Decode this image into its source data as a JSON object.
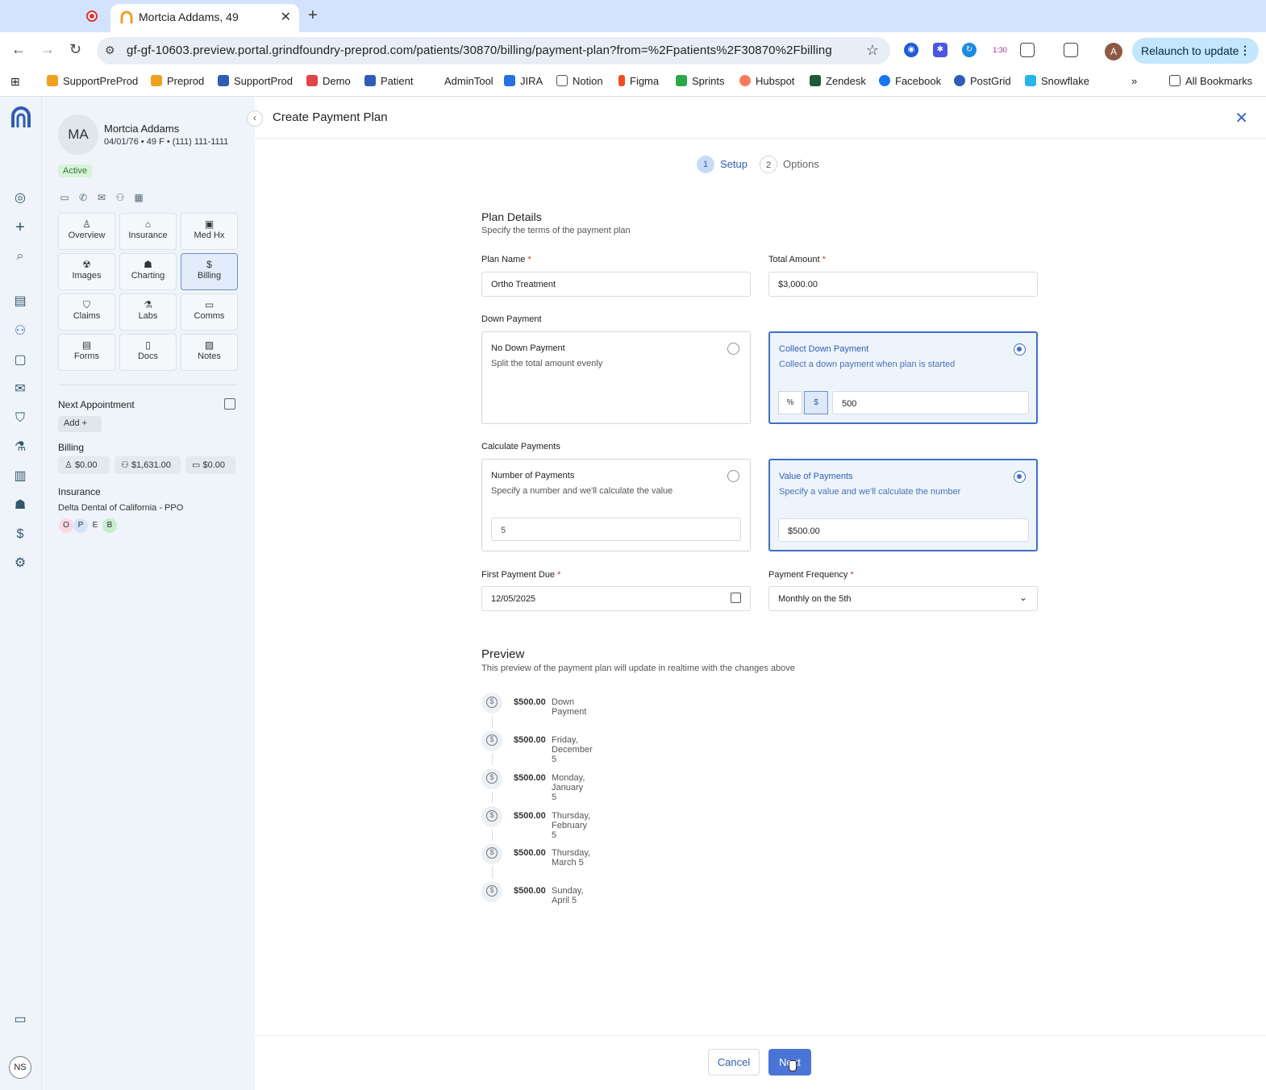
{
  "browser": {
    "tab_title": "Mortcia Addams, 49",
    "url": "gf-gf-10603.preview.portal.grindfoundry-preprod.com/patients/30870/billing/payment-plan?from=%2Fpatients%2F30870%2Fbilling",
    "relaunch_label": "Relaunch to update",
    "profile_initial": "A",
    "extension_badge": "1:30",
    "bookmarks": [
      "SupportPreProd",
      "Preprod",
      "SupportProd",
      "Demo",
      "Patient",
      "AdminTool",
      "JIRA",
      "Notion",
      "Figma",
      "Sprints",
      "Hubspot",
      "Zendesk",
      "Facebook",
      "PostGrid",
      "Snowflake"
    ],
    "all_bookmarks": "All Bookmarks"
  },
  "user": {
    "initials": "NS"
  },
  "patient": {
    "initials": "MA",
    "name": "Mortcia Addams",
    "meta": "04/01/76 • 49 F • (111) 111-1111",
    "status": "Active",
    "nav": [
      "Overview",
      "Insurance",
      "Med Hx",
      "Images",
      "Charting",
      "Billing",
      "Claims",
      "Labs",
      "Comms",
      "Forms",
      "Docs",
      "Notes"
    ],
    "selected_nav": "Billing",
    "next_appointment_label": "Next Appointment",
    "add_label": "Add",
    "billing_label": "Billing",
    "billing": [
      "$0.00",
      "$1,631.00",
      "$0.00"
    ],
    "insurance_label": "Insurance",
    "insurance_name": "Delta Dental of California - PPO",
    "insurance_badges": [
      "O",
      "P",
      "E",
      "B"
    ]
  },
  "page": {
    "title": "Create Payment Plan",
    "steps": [
      {
        "num": "1",
        "label": "Setup"
      },
      {
        "num": "2",
        "label": "Options"
      }
    ],
    "current_step": 1
  },
  "plan": {
    "section_title": "Plan Details",
    "section_sub": "Specify the terms of the payment plan",
    "plan_name_label": "Plan Name",
    "plan_name_value": "Ortho Treatment",
    "total_amount_label": "Total Amount",
    "total_amount_value": "$3,000.00",
    "down_payment_label": "Down Payment",
    "no_down_title": "No Down Payment",
    "no_down_sub": "Split the total amount evenly",
    "collect_down_title": "Collect Down Payment",
    "collect_down_sub": "Collect a down payment when plan is started",
    "down_unit_percent": "%",
    "down_unit_dollar": "$",
    "down_value": "500",
    "calc_label": "Calculate Payments",
    "num_payments_title": "Number of Payments",
    "num_payments_sub": "Specify a number and we'll calculate the value",
    "num_payments_value": "5",
    "value_payments_title": "Value of Payments",
    "value_payments_sub": "Specify a value and we'll calculate the number",
    "value_payments_value": "$500.00",
    "first_due_label": "First Payment Due",
    "first_due_value": "12/05/2025",
    "frequency_label": "Payment Frequency",
    "frequency_value": "Monthly on the 5th"
  },
  "preview": {
    "title": "Preview",
    "sub": "This preview of the payment plan will update in realtime with the changes above",
    "items": [
      {
        "amount": "$500.00",
        "label": "Down Payment"
      },
      {
        "amount": "$500.00",
        "label": "Friday, December 5"
      },
      {
        "amount": "$500.00",
        "label": "Monday, January 5"
      },
      {
        "amount": "$500.00",
        "label": "Thursday, February 5"
      },
      {
        "amount": "$500.00",
        "label": "Thursday, March 5"
      },
      {
        "amount": "$500.00",
        "label": "Sunday, April 5"
      }
    ]
  },
  "footer": {
    "cancel": "Cancel",
    "next": "Next"
  },
  "colors": {
    "accent": "#3f6ec9",
    "primary_button": "#4a74d6",
    "active_badge": "#d9f2da",
    "chrome": "#d3e3fd"
  }
}
